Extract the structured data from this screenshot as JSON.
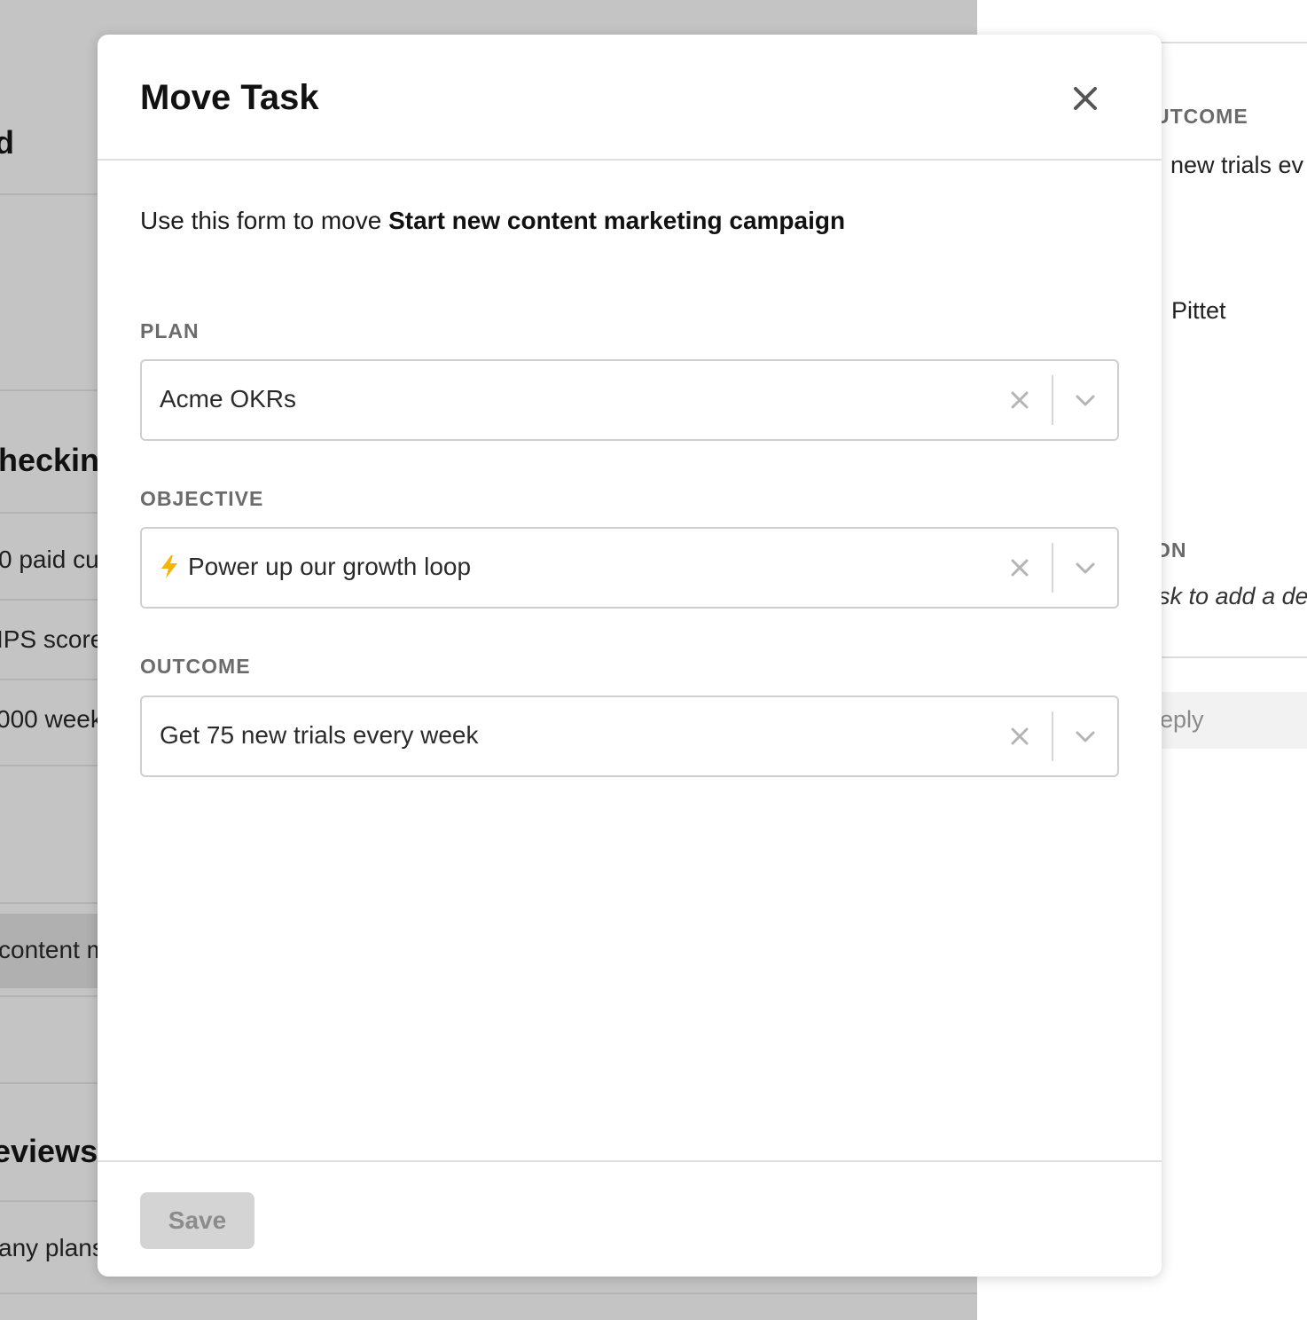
{
  "background": {
    "left_items": [
      {
        "id": "heading-top",
        "text": "d"
      },
      {
        "id": "heading-checkins",
        "text": "heckins"
      },
      {
        "id": "row-1",
        "text": "0 paid cu"
      },
      {
        "id": "row-2",
        "text": "IPS score"
      },
      {
        "id": "row-3",
        "text": "000 week"
      },
      {
        "id": "row-4",
        "text": "content m"
      },
      {
        "id": "heading-reviews",
        "text": "eviews"
      },
      {
        "id": "row-5",
        "text": "any plans"
      }
    ],
    "right_panel": {
      "outcome_label": "UTCOME",
      "outcome_value": "new trials ev",
      "owner_value": "Pittet",
      "description_label": "ON",
      "description_placeholder": "sk to add a de",
      "reply_placeholder": "eply"
    }
  },
  "modal": {
    "title": "Move Task",
    "intro_prefix": "Use this form to move ",
    "task_name": "Start new content marketing campaign",
    "fields": {
      "plan": {
        "label": "PLAN",
        "value": "Acme OKRs"
      },
      "objective": {
        "label": "OBJECTIVE",
        "emoji": "lightning-bolt",
        "value": "Power up our growth loop"
      },
      "outcome": {
        "label": "OUTCOME",
        "value": "Get 75 new trials every week"
      }
    },
    "save_label": "Save",
    "save_disabled": true
  },
  "colors": {
    "overlay_gray": "#c4c4c4",
    "bolt_yellow": "#f5b400",
    "label_gray": "#6b6b6b",
    "save_bg": "#d4d4d4",
    "save_text": "#8c8c8c"
  }
}
